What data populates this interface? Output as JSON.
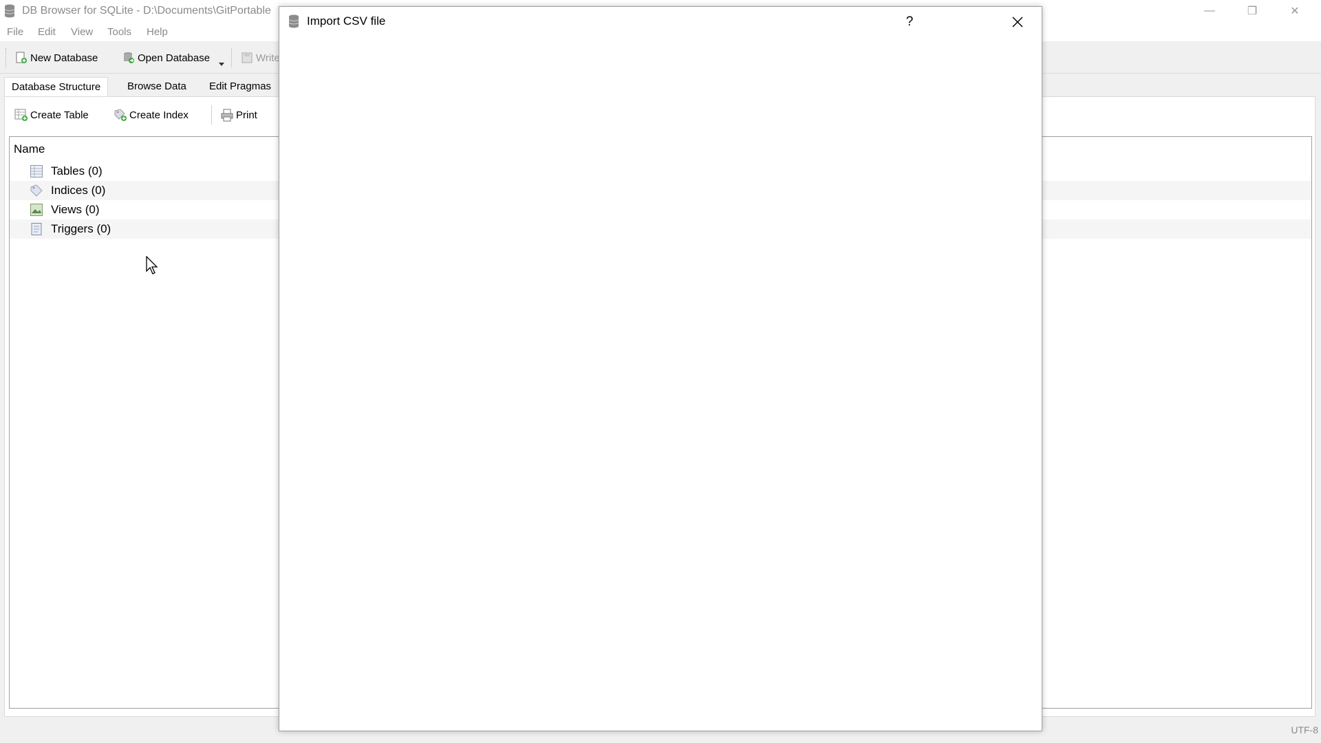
{
  "window": {
    "title": "DB Browser for SQLite - D:\\Documents\\GitPortable",
    "controls": {
      "minimize": "—",
      "restore": "❐",
      "close": "✕"
    }
  },
  "menu": [
    "File",
    "Edit",
    "View",
    "Tools",
    "Help"
  ],
  "toolbar": {
    "new_database": "New Database",
    "open_database": "Open Database",
    "write_changes": "Write"
  },
  "tabs": [
    "Database Structure",
    "Browse Data",
    "Edit Pragmas"
  ],
  "structure_toolbar": {
    "create_table": "Create Table",
    "create_index": "Create Index",
    "print": "Print"
  },
  "tree": {
    "header": "Name",
    "items": [
      {
        "label": "Tables (0)",
        "icon": "table-icon"
      },
      {
        "label": "Indices (0)",
        "icon": "index-icon"
      },
      {
        "label": "Views (0)",
        "icon": "view-icon"
      },
      {
        "label": "Triggers (0)",
        "icon": "trigger-icon"
      }
    ]
  },
  "status": {
    "encoding": "UTF-8"
  },
  "dialog": {
    "title": "Import CSV file",
    "help": "?",
    "close": "✕"
  },
  "colors": {
    "window_bg": "#f0f0f0",
    "panel_bg": "#ffffff",
    "muted_text": "#8a8a8a",
    "border": "#9e9e9e"
  }
}
